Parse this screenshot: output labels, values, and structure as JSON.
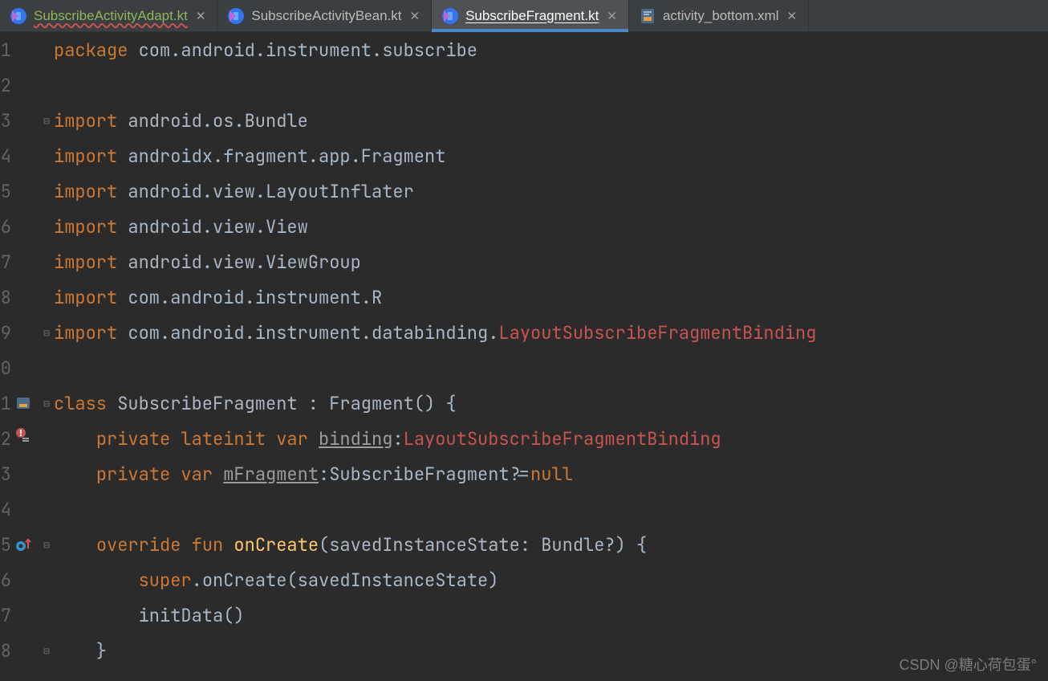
{
  "tabs": [
    {
      "label": "SubscribeActivityAdapt.kt",
      "kind": "kotlin_class",
      "modified": true,
      "active": false
    },
    {
      "label": "SubscribeActivityBean.kt",
      "kind": "kotlin_class",
      "modified": false,
      "active": false
    },
    {
      "label": "SubscribeFragment.kt",
      "kind": "kotlin_class",
      "modified": false,
      "active": true
    },
    {
      "label": "activity_bottom.xml",
      "kind": "xml",
      "modified": false,
      "active": false
    }
  ],
  "watermark": "CSDN @糖心荷包蛋°",
  "line_numbers": [
    "1",
    "2",
    "3",
    "4",
    "5",
    "6",
    "7",
    "8",
    "9",
    "0",
    "1",
    "2",
    "3",
    "4",
    "5",
    "6",
    "7",
    "8"
  ],
  "code": {
    "l1": {
      "kw": "package ",
      "rest": "com.android.instrument.subscribe"
    },
    "l3": {
      "kw": "import ",
      "rest": "android.os.Bundle"
    },
    "l4": {
      "kw": "import ",
      "rest": "androidx.fragment.app.Fragment"
    },
    "l5": {
      "kw": "import ",
      "rest": "android.view.LayoutInflater"
    },
    "l6": {
      "kw": "import ",
      "rest": "android.view.View"
    },
    "l7": {
      "kw": "import ",
      "rest": "android.view.ViewGroup"
    },
    "l8": {
      "kw": "import ",
      "rest": "com.android.instrument.R"
    },
    "l9": {
      "kw": "import ",
      "rest": "com.android.instrument.databinding.",
      "err": "LayoutSubscribeFragmentBinding"
    },
    "l11a": "class ",
    "l11b": "SubscribeFragment : Fragment() {",
    "l12a": "    ",
    "l12b": "private lateinit var ",
    "l12c": "binding",
    "l12d": ":",
    "l12e": "LayoutSubscribeFragmentBinding",
    "l13a": "    ",
    "l13b": "private var ",
    "l13c": "mFragment",
    "l13d": ":SubscribeFragment?=",
    "l13e": "null",
    "l15a": "    ",
    "l15b": "override fun ",
    "l15c": "onCreate",
    "l15d": "(savedInstanceState: Bundle?) {",
    "l16a": "        ",
    "l16b": "super",
    "l16c": ".onCreate(savedInstanceState)",
    "l17": "        initData()",
    "l18": "    }"
  }
}
